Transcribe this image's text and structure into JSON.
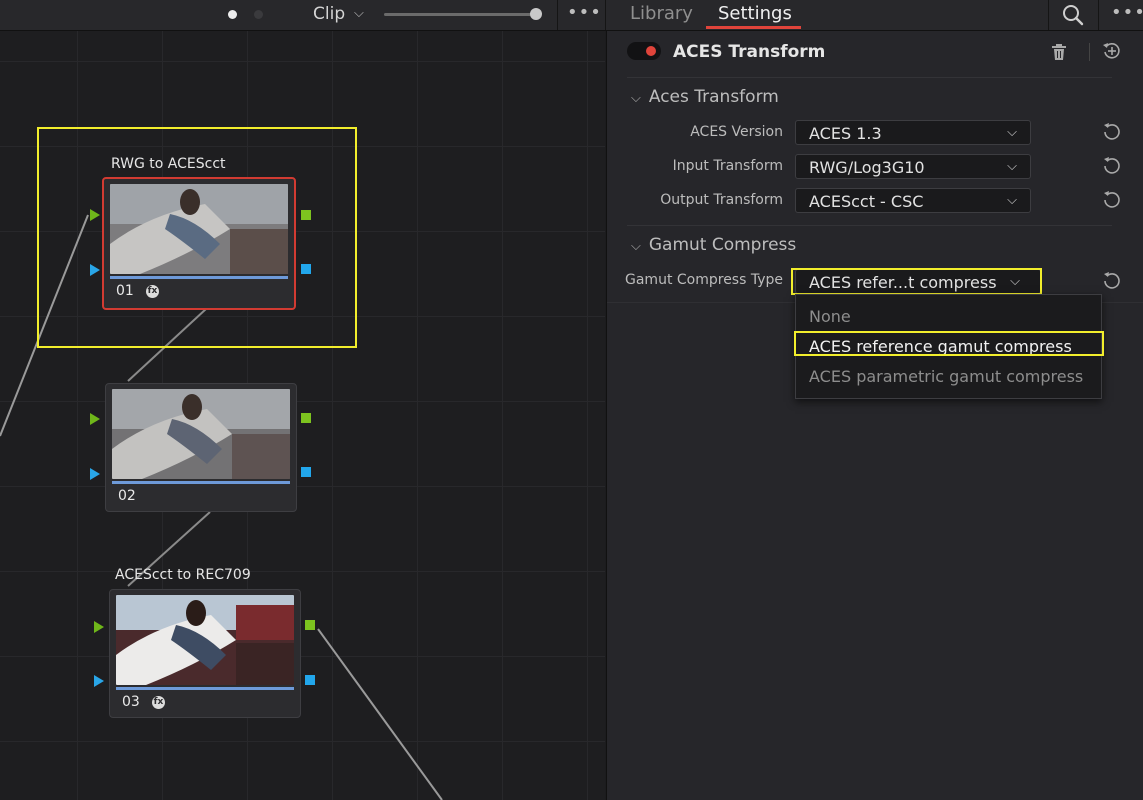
{
  "topbar": {
    "clip_label": "Clip",
    "chevron": "⌵",
    "more": "•••",
    "tabs": [
      {
        "label": "Library",
        "active": false
      },
      {
        "label": "Settings",
        "active": true
      }
    ],
    "icons": [
      "search-icon",
      "more-icon"
    ]
  },
  "graph": {
    "nodes": [
      {
        "label": "RWG to ACEScct",
        "number": "01",
        "has_fx": true,
        "selected": true
      },
      {
        "label": "",
        "number": "02",
        "has_fx": false,
        "selected": false
      },
      {
        "label": "ACEScct to REC709",
        "number": "03",
        "has_fx": true,
        "selected": false
      }
    ],
    "fx_glyph": "fx"
  },
  "panel": {
    "title": "ACES Transform",
    "enabled": true,
    "sections": [
      {
        "heading": "Aces Transform",
        "rows": [
          {
            "label": "ACES Version",
            "value": "ACES 1.3"
          },
          {
            "label": "Input Transform",
            "value": "RWG/Log3G10"
          },
          {
            "label": "Output Transform",
            "value": "ACEScct - CSC"
          }
        ]
      },
      {
        "heading": "Gamut Compress",
        "rows": [
          {
            "label": "Gamut Compress Type",
            "value": "ACES refer...t compress"
          }
        ]
      }
    ],
    "dropdown": {
      "options": [
        "None",
        "ACES reference gamut compress",
        "ACES parametric gamut compress"
      ],
      "selected": "ACES reference gamut compress"
    },
    "caret": "⌵",
    "section_chevron": "⌵"
  },
  "colors": {
    "accent_red": "#e0443b",
    "highlight_yellow": "#f2ee2c",
    "port_green": "#7dc31f",
    "port_blue": "#22a7ec"
  }
}
